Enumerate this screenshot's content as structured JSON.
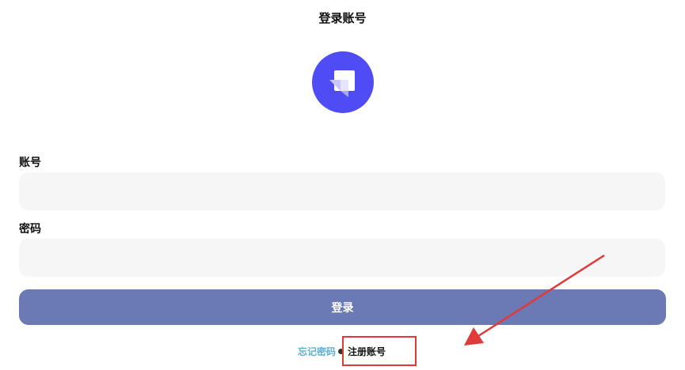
{
  "header": {
    "title": "登录账号"
  },
  "logo": {
    "icon": "app-logo-icon",
    "background_color": "#4f4cf5"
  },
  "form": {
    "account_label": "账号",
    "account_value": "",
    "account_placeholder": "",
    "password_label": "密码",
    "password_value": "",
    "password_placeholder": "",
    "login_button_label": "登录",
    "login_button_color": "#6b79b4"
  },
  "footer": {
    "forgot_password_label": "忘记密码",
    "register_label": "注册账号"
  },
  "annotation": {
    "highlight_color": "#e03a3a"
  }
}
